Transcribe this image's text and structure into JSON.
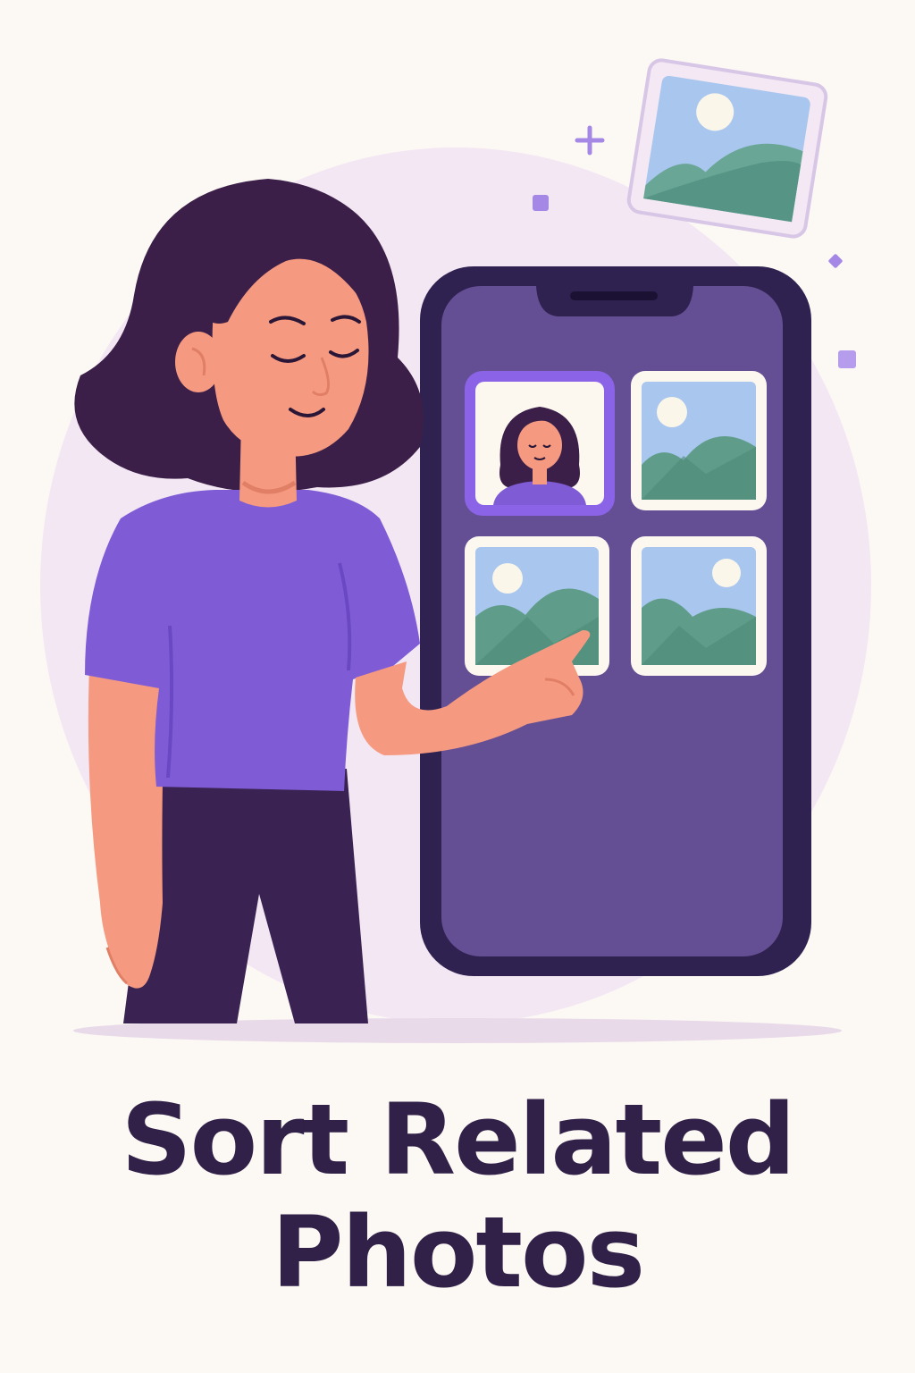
{
  "title": {
    "line1": "Sort Related",
    "line2": "Photos"
  },
  "phone": {
    "grid": [
      {
        "kind": "portrait",
        "selected": true
      },
      {
        "kind": "landscape",
        "selected": false
      },
      {
        "kind": "landscape",
        "selected": false
      },
      {
        "kind": "landscape",
        "selected": false
      }
    ]
  },
  "colors": {
    "background": "#fcf9f5",
    "blob": "#f3e7f3",
    "phone_body": "#2f2250",
    "phone_screen": "#654f94",
    "selection": "#8b63e6",
    "shirt": "#7f5cd6",
    "hair": "#3b1f48",
    "skin": "#f59a80",
    "pants": "#3a2352",
    "sky": "#a9c6ee",
    "hill": "#5f9d8a",
    "sun": "#fbf6ea",
    "title": "#312148"
  },
  "icons": [
    "sparkle-plus-icon",
    "floating-photo-icon",
    "photo-thumbnail-icon"
  ]
}
